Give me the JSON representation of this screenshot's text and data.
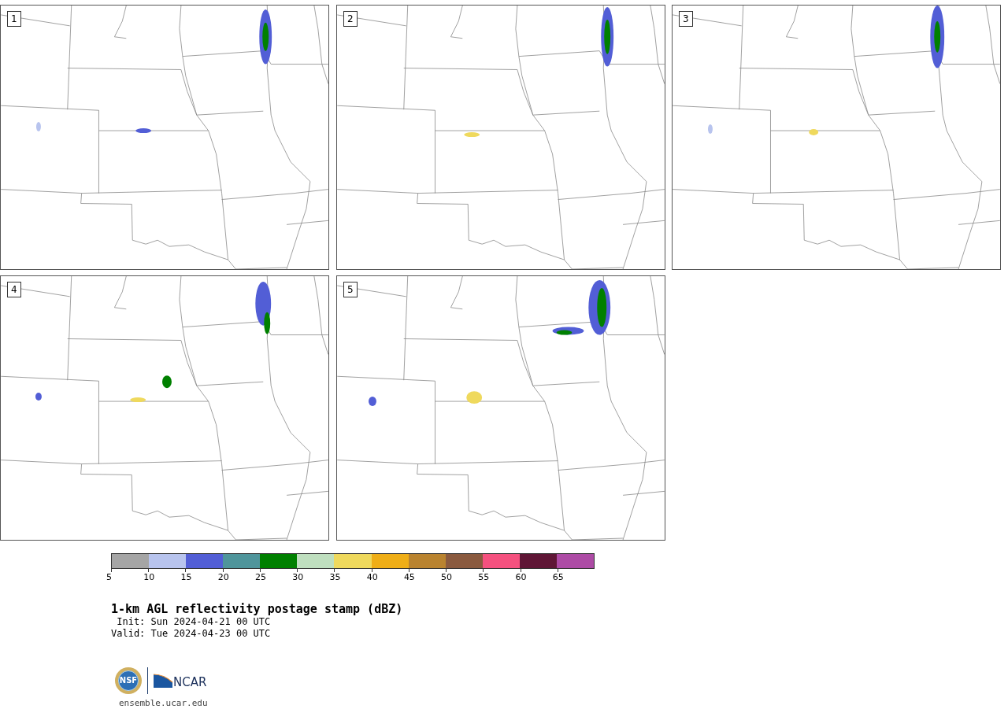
{
  "panels": [
    {
      "number": "1"
    },
    {
      "number": "2"
    },
    {
      "number": "3"
    },
    {
      "number": "4"
    },
    {
      "number": "5"
    }
  ],
  "colorbar": {
    "bins": [
      {
        "tick": "5",
        "color": "#a5a5a5"
      },
      {
        "tick": "10",
        "color": "#b8c4ee"
      },
      {
        "tick": "15",
        "color": "#525ed6"
      },
      {
        "tick": "20",
        "color": "#4f959b"
      },
      {
        "tick": "25",
        "color": "#008000"
      },
      {
        "tick": "30",
        "color": "#bfdfbf"
      },
      {
        "tick": "35",
        "color": "#efd95d"
      },
      {
        "tick": "40",
        "color": "#efae17"
      },
      {
        "tick": "45",
        "color": "#b9832f"
      },
      {
        "tick": "50",
        "color": "#8a5a3f"
      },
      {
        "tick": "55",
        "color": "#f5517f"
      },
      {
        "tick": "60",
        "color": "#5f1636"
      },
      {
        "tick": "65",
        "color": "#ad4ba5"
      }
    ]
  },
  "title": "1-km AGL reflectivity postage stamp (dBZ)",
  "init": " Init: Sun 2024-04-21 00 UTC",
  "valid": "Valid: Tue 2024-04-23 00 UTC",
  "logos": {
    "nsf": "NSF",
    "ncar": "NCAR"
  },
  "site": "ensemble.ucar.edu"
}
